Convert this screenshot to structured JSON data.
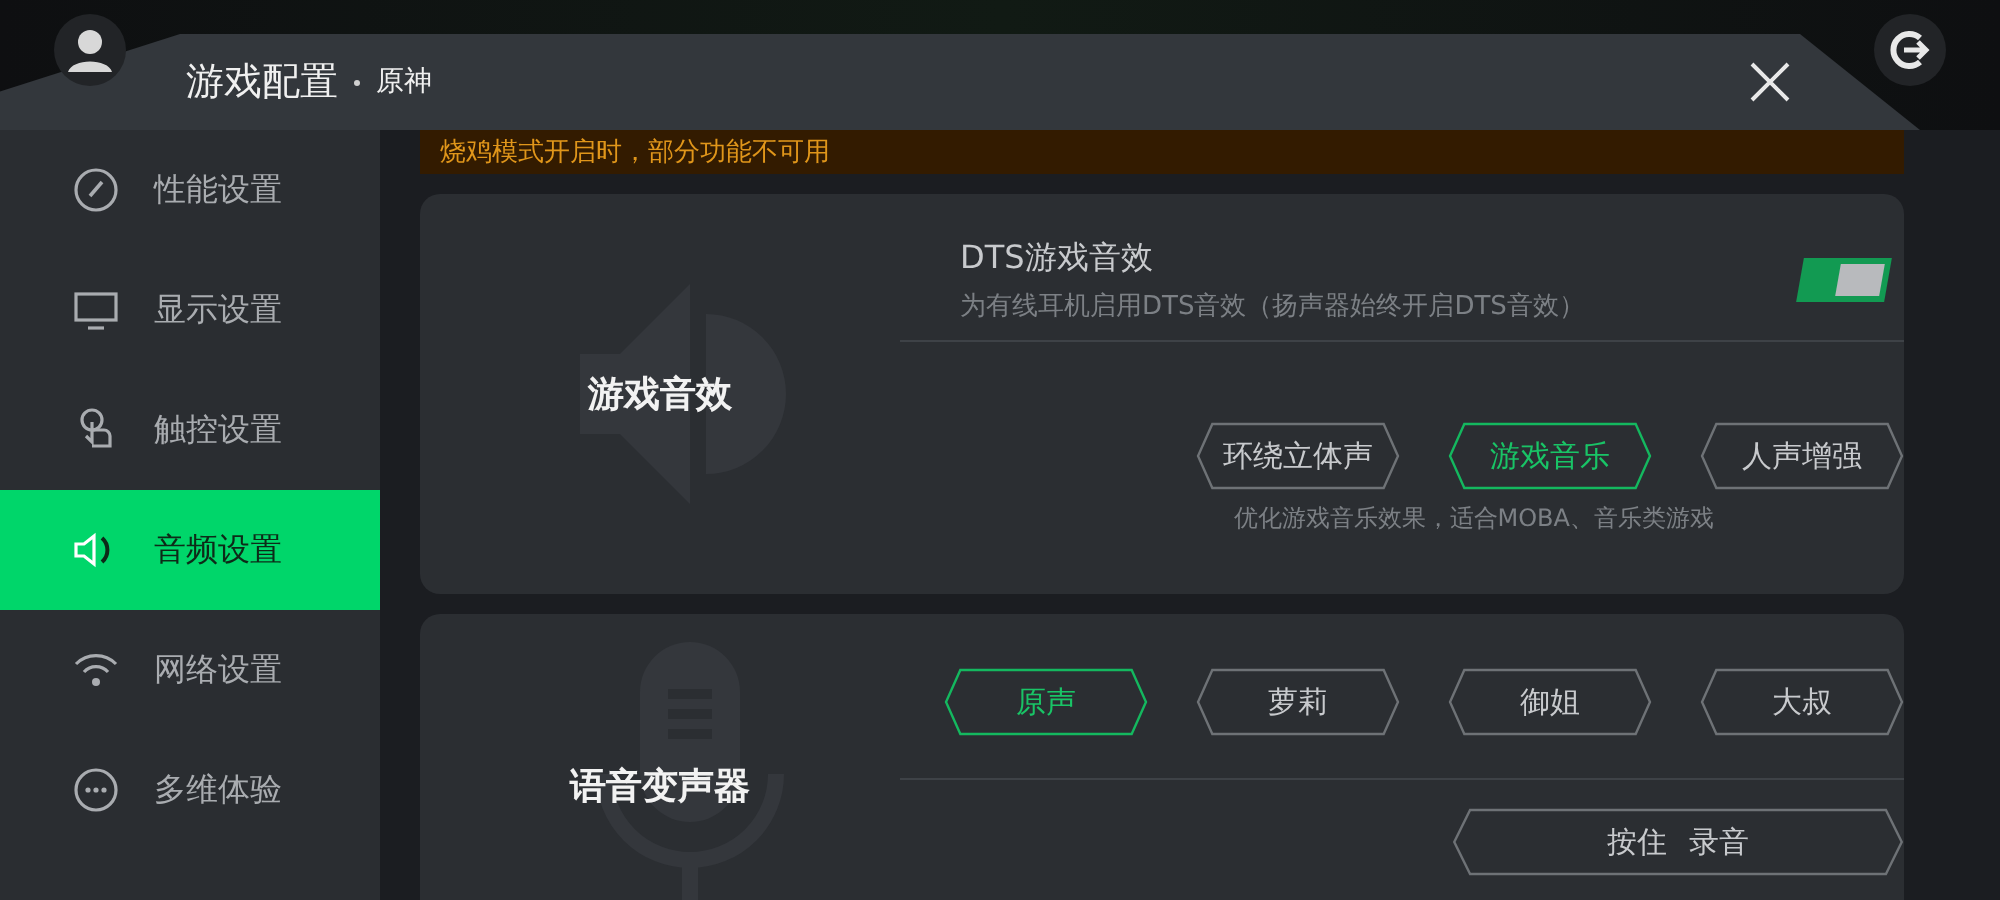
{
  "header": {
    "title": "游戏配置",
    "subtitle": "原神"
  },
  "sidebar": {
    "items": [
      {
        "label": "性能设置",
        "selected": false
      },
      {
        "label": "显示设置",
        "selected": false
      },
      {
        "label": "触控设置",
        "selected": false
      },
      {
        "label": "音频设置",
        "selected": true
      },
      {
        "label": "网络设置",
        "selected": false
      },
      {
        "label": "多维体验",
        "selected": false
      }
    ]
  },
  "warning": "烧鸡模式开启时，部分功能不可用",
  "sound_effects": {
    "label": "游戏音效",
    "dts": {
      "title": "DTS游戏音效",
      "description": "为有线耳机启用DTS音效（扬声器始终开启DTS音效）",
      "on": true
    },
    "modes": [
      {
        "label": "环绕立体声",
        "selected": false
      },
      {
        "label": "游戏音乐",
        "selected": true
      },
      {
        "label": "人声增强",
        "selected": false
      }
    ],
    "hint": "优化游戏音乐效果，适合MOBA、音乐类游戏"
  },
  "voice_changer": {
    "label": "语音变声器",
    "voices": [
      {
        "label": "原声",
        "selected": true
      },
      {
        "label": "萝莉",
        "selected": false
      },
      {
        "label": "御姐",
        "selected": false
      },
      {
        "label": "大叔",
        "selected": false
      }
    ],
    "record_button": "按住 录音"
  }
}
